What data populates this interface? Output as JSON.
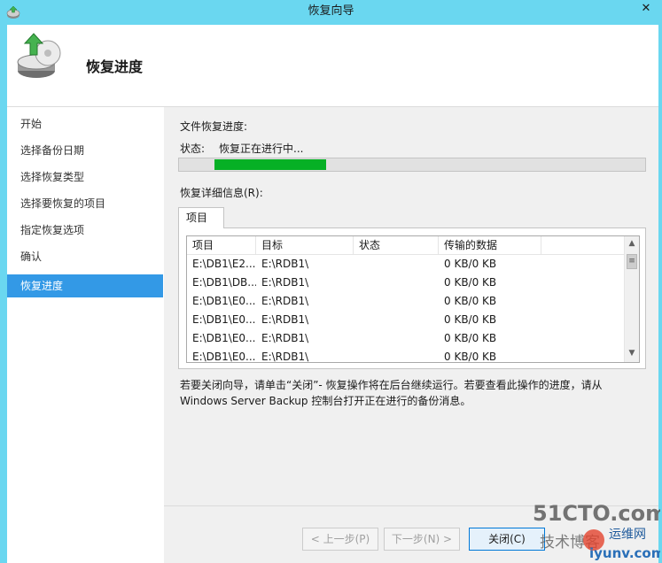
{
  "window": {
    "title": "恢复向导",
    "close_glyph": "✕"
  },
  "header": {
    "title": "恢复进度",
    "icon": "backup-restore-disk-icon"
  },
  "steps": [
    {
      "label": "开始"
    },
    {
      "label": "选择备份日期"
    },
    {
      "label": "选择恢复类型"
    },
    {
      "label": "选择要恢复的项目"
    },
    {
      "label": "指定恢复选项"
    },
    {
      "label": "确认"
    },
    {
      "label": "恢复进度",
      "active": true
    }
  ],
  "progress": {
    "section_label": "文件恢复进度:",
    "status_label": "状态:",
    "status_value": "恢复正在进行中...",
    "fill_fraction": 0.24
  },
  "details": {
    "label": "恢复详细信息(R):",
    "tab_label": "项目",
    "columns": [
      "项目",
      "目标",
      "状态",
      "传输的数据"
    ],
    "rows": [
      [
        "E:\\DB1\\E2...",
        "E:\\RDB1\\",
        "",
        "0 KB/0 KB"
      ],
      [
        "E:\\DB1\\DB...",
        "E:\\RDB1\\",
        "",
        "0 KB/0 KB"
      ],
      [
        "E:\\DB1\\E0...",
        "E:\\RDB1\\",
        "",
        "0 KB/0 KB"
      ],
      [
        "E:\\DB1\\E0...",
        "E:\\RDB1\\",
        "",
        "0 KB/0 KB"
      ],
      [
        "E:\\DB1\\E0...",
        "E:\\RDB1\\",
        "",
        "0 KB/0 KB"
      ],
      [
        "E:\\DB1\\E0...",
        "E:\\RDB1\\",
        "",
        "0 KB/0 KB"
      ]
    ]
  },
  "note": {
    "line1": "若要关闭向导，请单击“关闭”- 恢复操作将在后台继续运行。若要查看此操作的进度，请从",
    "line2": "Windows Server Backup 控制台打开正在进行的备份消息。"
  },
  "buttons": {
    "back": "< 上一步(P)",
    "next": "下一步(N) >",
    "close": "关闭(C)"
  },
  "watermark": {
    "site": "51CTO.com",
    "tagline": "技术博客",
    "brand": "运维网",
    "url": "iyunv.com"
  },
  "colors": {
    "titlebar": "#6ad7f0",
    "active_step": "#3399e6",
    "progress_fill": "#06b025"
  }
}
